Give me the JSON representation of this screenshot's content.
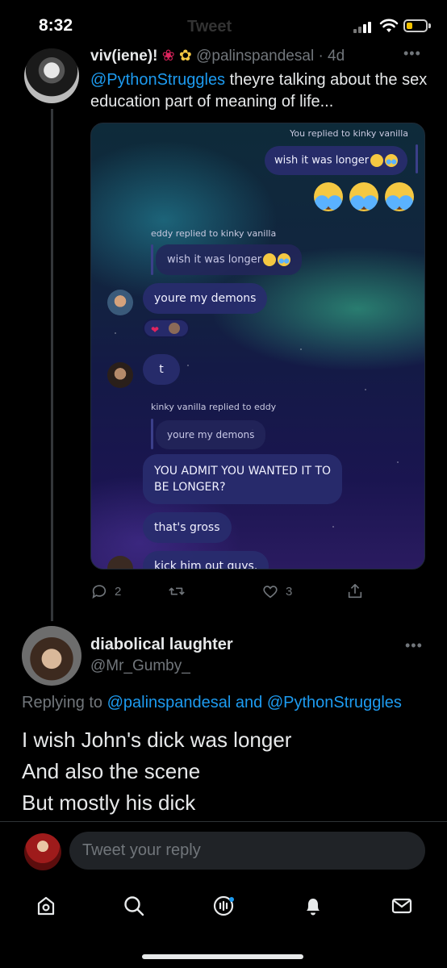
{
  "status_bar": {
    "time": "8:32",
    "title_ghost": "Tweet"
  },
  "tweet1": {
    "display_name": "viv(iene)!",
    "handle": "@palinspandesal",
    "age": "· 4d",
    "text_mention": "@PythonStruggles",
    "text_rest": " theyre talking about the sex education part of meaning of life...",
    "media": {
      "caption_top": "You replied to kinky vanilla",
      "bubble_reply": "wish it was longer",
      "caption_eddy": "eddy replied to kinky vanilla",
      "quote_eddy": "wish it was longer",
      "bubble_demons": "youre my demons",
      "bubble_t": "t",
      "caption_kinky": "kinky vanilla replied to eddy",
      "quote_demons": "youre my demons",
      "bubble_admit_line1": "YOU ADMIT YOU WANTED IT TO",
      "bubble_admit_line2": "BE LONGER?",
      "bubble_gross": "that's gross",
      "bubble_kick": "kick him out guys."
    },
    "actions": {
      "replies": "2",
      "retweets": "",
      "likes": "3"
    }
  },
  "tweet2": {
    "display_name": "diabolical laughter",
    "handle": "@Mr_Gumby_",
    "replying_prefix": "Replying to ",
    "replying_user1": "@palinspandesal",
    "replying_and": " and ",
    "replying_user2": "@PythonStruggles",
    "line1": "I wish John's dick was longer",
    "line2": "And also the scene",
    "line3": "But mostly his dick"
  },
  "reply_box": {
    "placeholder": "Tweet your reply"
  },
  "colors": {
    "accent": "#1d9bf0",
    "muted": "#71767b",
    "background": "#000000"
  },
  "nav": {
    "icons": [
      "home-icon",
      "search-icon",
      "spaces-icon",
      "notifications-icon",
      "messages-icon"
    ]
  }
}
